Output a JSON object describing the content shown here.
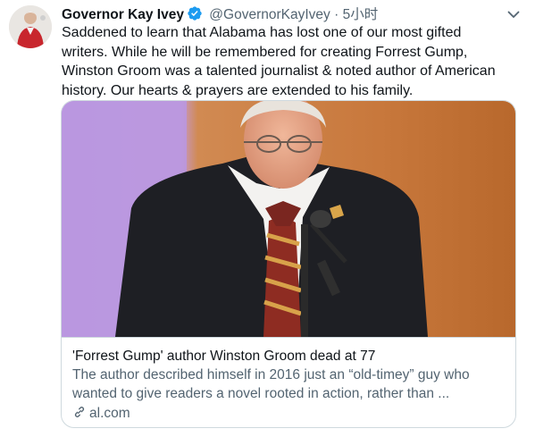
{
  "tweet": {
    "author_name": "Governor Kay Ivey",
    "handle": "@GovernorKayIvey",
    "separator": "·",
    "time": "5小时",
    "text": "Saddened to learn that Alabama has lost one of our most gifted\nwriters. While he will be remembered for creating Forrest Gump,\nWinston Groom was a talented journalist & noted author of American\nhistory. Our hearts & prayers are extended to his family."
  },
  "card": {
    "title": "'Forrest Gump' author Winston Groom dead at 77",
    "description": "The author described himself in 2016 just an “old-timey” guy who\nwanted to give readers a novel rooted in action, rather than ...",
    "domain": "al.com"
  },
  "icons": {
    "verified": "verified-badge-icon",
    "more": "chevron-down-icon",
    "link": "link-icon"
  },
  "colors": {
    "verified": "#1d9bf0",
    "secondary_text": "#536471",
    "card_border": "#cfd9de"
  }
}
